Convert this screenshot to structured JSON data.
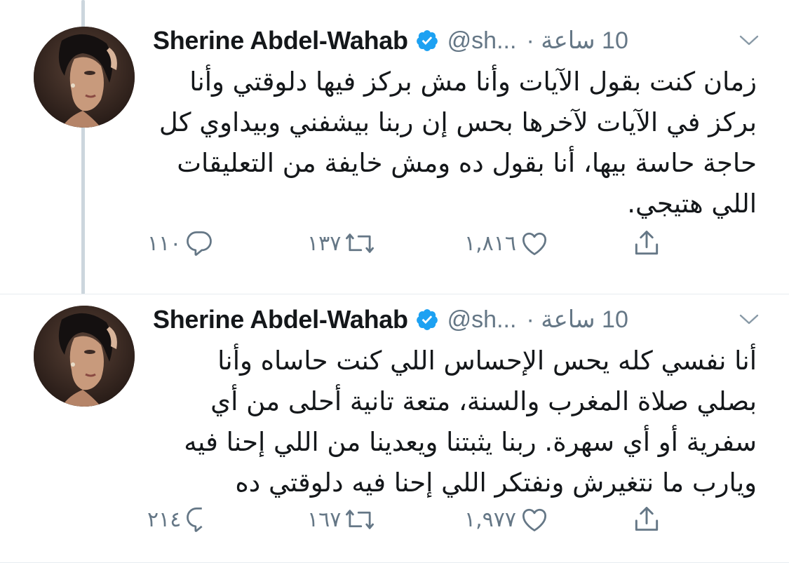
{
  "colors": {
    "text": "#14171a",
    "secondary": "#657786",
    "verified": "#1da1f2",
    "thread_line": "#ccd6dd"
  },
  "tweets": [
    {
      "name": "Sherine Abdel-Wahab",
      "handle": "@sh...",
      "separator": "·",
      "time": "10 ساعة",
      "text": "زمان كنت بقول الآيات وأنا مش بركز فيها دلوقتي وأنا بركز في الآيات لآخرها بحس إن ربنا بيشفني وبيداوي كل حاجة حاسة بيها، أنا بقول ده ومش خايفة من التعليقات اللي هتيجي.",
      "replies": "١١٠",
      "retweets": "١٣٧",
      "likes": "١,٨١٦",
      "icons": [
        "reply-icon",
        "retweet-icon",
        "like-icon",
        "share-icon",
        "verified-icon",
        "chevron-down-icon"
      ]
    },
    {
      "name": "Sherine Abdel-Wahab",
      "handle": "@sh...",
      "separator": "·",
      "time": "10 ساعة",
      "text": "أنا نفسي كله يحس الإحساس اللي كنت حاساه وأنا بصلي صلاة المغرب والسنة، متعة تانية أحلى من أي سفرية أو أي سهرة. ربنا يثبتنا ويعدينا من اللي إحنا فيه ويارب ما نتغيرش ونفتكر اللي إحنا فيه دلوقتي ده",
      "replies": "٢١٤",
      "retweets": "١٦٧",
      "likes": "١,٩٧٧",
      "icons": [
        "reply-icon",
        "retweet-icon",
        "like-icon",
        "share-icon",
        "verified-icon",
        "chevron-down-icon"
      ]
    }
  ]
}
